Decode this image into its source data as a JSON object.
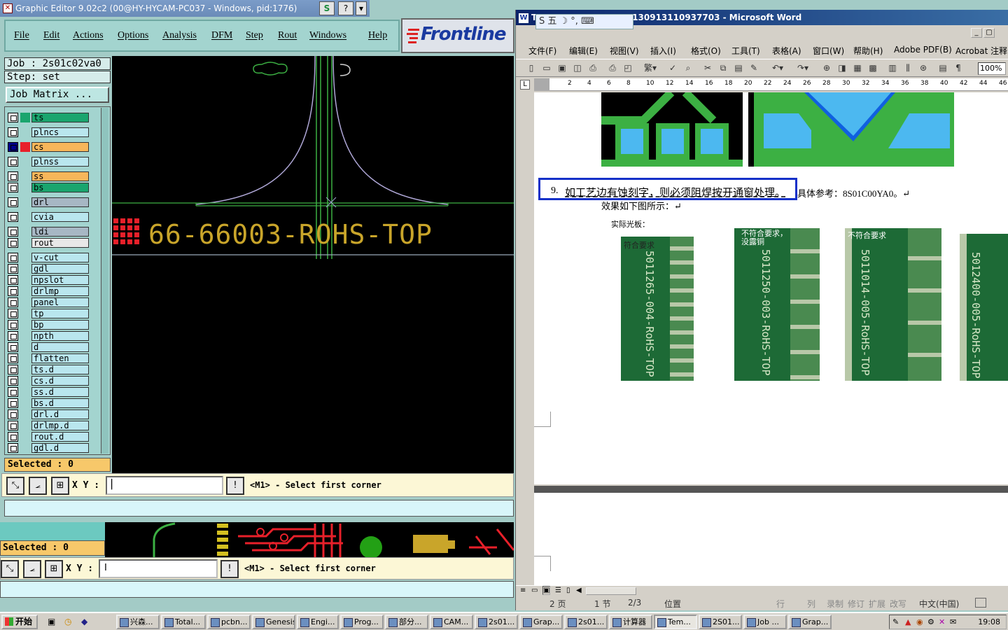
{
  "genesis": {
    "title": "Graphic Editor 9.02c2 (00@HY-HYCAM-PC037 - Windows, pid:1776)",
    "title_buttons": [
      "S",
      "?",
      "▾"
    ],
    "menu": [
      "File",
      "Edit",
      "Actions",
      "Options",
      "Analysis",
      "DFM",
      "Step",
      "Rout",
      "Windows",
      "Help"
    ],
    "logo": "Frontline",
    "job": "Job : 2s01c02va0",
    "step": "Step: set",
    "job_matrix": "Job Matrix ...",
    "layers": [
      {
        "name": "ts",
        "color": "#1aa56e"
      },
      {
        "name": "plncs",
        "color": "#b9e6ee"
      },
      {
        "name": "cs",
        "color": "#f7b65a"
      },
      {
        "name": "plnss",
        "color": "#b9e6ee"
      },
      {
        "name": "ss",
        "color": "#f7b65a"
      },
      {
        "name": "bs",
        "color": "#1aa56e"
      },
      {
        "name": "drl",
        "color": "#a7b7c4"
      },
      {
        "name": "cvia",
        "color": "#b9e6ee"
      },
      {
        "name": "ldi",
        "color": "#a7b7c4"
      },
      {
        "name": "rout",
        "color": "#e8e8e8"
      },
      {
        "name": "v-cut",
        "color": "#b9e6ee"
      },
      {
        "name": "gdl",
        "color": "#b9e6ee"
      },
      {
        "name": "npslot",
        "color": "#b9e6ee"
      },
      {
        "name": "drlmp",
        "color": "#b9e6ee"
      },
      {
        "name": "panel",
        "color": "#b9e6ee"
      },
      {
        "name": "tp",
        "color": "#b9e6ee"
      },
      {
        "name": "bp",
        "color": "#b9e6ee"
      },
      {
        "name": "npth",
        "color": "#b9e6ee"
      },
      {
        "name": "d",
        "color": "#b9e6ee"
      },
      {
        "name": "flatten",
        "color": "#b9e6ee"
      },
      {
        "name": "ts.d",
        "color": "#b9e6ee"
      },
      {
        "name": "cs.d",
        "color": "#b9e6ee"
      },
      {
        "name": "ss.d",
        "color": "#b9e6ee"
      },
      {
        "name": "bs.d",
        "color": "#b9e6ee"
      },
      {
        "name": "drl.d",
        "color": "#b9e6ee"
      },
      {
        "name": "drlmp.d",
        "color": "#b9e6ee"
      },
      {
        "name": "rout.d",
        "color": "#b9e6ee"
      },
      {
        "name": "gdl.d",
        "color": "#b9e6ee"
      }
    ],
    "selected": "Selected : 0",
    "canvas_text": "66-66003-ROHS-TOP",
    "xy_label": "X Y :",
    "prompt": "<M1> - Select first corner",
    "cmd_buttons": [
      "⤡",
      "⦟",
      "⊞",
      "!"
    ]
  },
  "word": {
    "title": "130913110937703 - Microsoft Word",
    "title_prefix": "T",
    "ime": "S 五 ☽ °, ⌨",
    "menu": [
      "文件(F)",
      "编辑(E)",
      "视图(V)",
      "插入(I)",
      "格式(O)",
      "工具(T)",
      "表格(A)",
      "窗口(W)",
      "帮助(H)",
      "Adobe PDF(B)",
      "Acrobat 注释"
    ],
    "zoom": "100%",
    "ruler": [
      "2",
      "4",
      "6",
      "8",
      "10",
      "12",
      "14",
      "16",
      "18",
      "20",
      "22",
      "24",
      "26",
      "28",
      "30",
      "32",
      "34",
      "36",
      "38",
      "40",
      "42",
      "44",
      "46"
    ],
    "item9_num": "9.",
    "item9_text": "如工艺边有蚀刻字，则必须阻焊按开通窗处理。",
    "item9_tail": "具体参考：8S01C00YA0。↵",
    "effect_line": "效果如下图所示：↵",
    "photo_caption": "实际光板：",
    "photo_labels": [
      "符合要求",
      "不符合要求，\n没露铜",
      "不符合要求",
      ""
    ],
    "photo_texts": [
      "5011265-004-RoHS-TOP",
      "5011250-003-RoHS-TOP",
      "5011014-005-RoHS-TOP",
      "5012400-005-RoHS-TOP"
    ],
    "status": [
      "2 页",
      "1 节",
      "2/3",
      "位置",
      "行",
      "列",
      "录制",
      "修订",
      "扩展",
      "改写",
      "中文(中国)"
    ]
  },
  "taskbar": {
    "start": "开始",
    "tasks": [
      "兴森...",
      "Total...",
      "pcbn...",
      "Genesis",
      "Engi...",
      "Prog...",
      "部分...",
      "CAM...",
      "2s01...",
      "Grap...",
      "2s01...",
      "计算器",
      "Tem...",
      "2S01...",
      "Job ...",
      "Grap..."
    ],
    "clock": "19:08"
  }
}
